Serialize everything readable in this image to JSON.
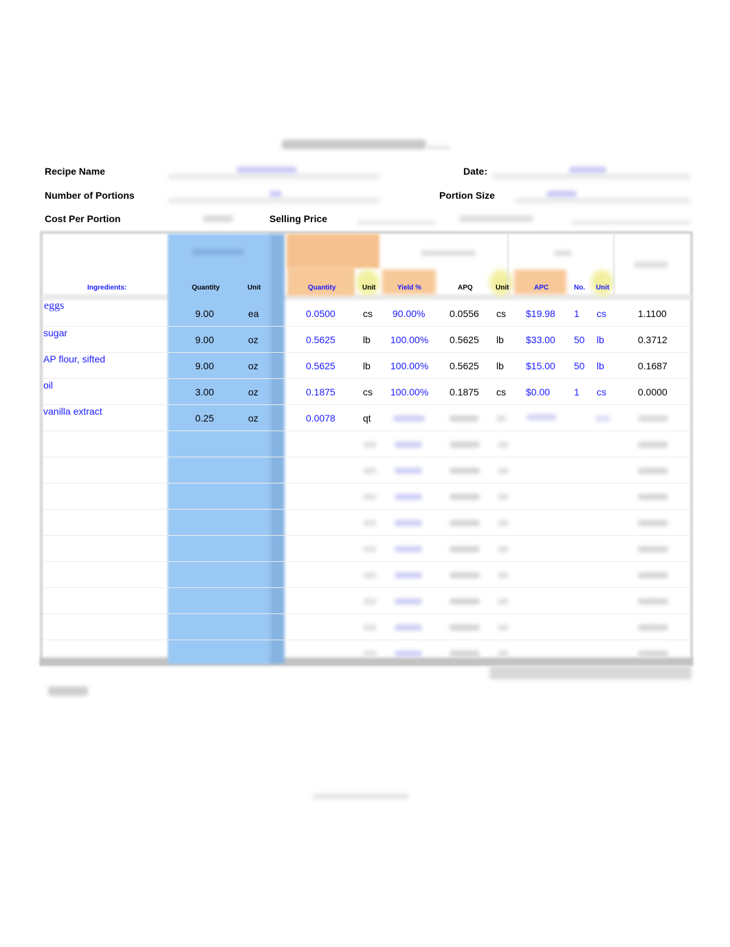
{
  "form": {
    "labels": {
      "recipe_name": "Recipe Name",
      "date": "Date:",
      "number_of_portions": "Number of Portions",
      "portion_size": "Portion Size",
      "cost_per_portion": "Cost Per Portion",
      "selling_price": "Selling Price"
    }
  },
  "table": {
    "headers": {
      "ingredients": "Ingredients:",
      "recipe_quantity": "Quantity",
      "recipe_unit": "Unit",
      "conv_quantity": "Quantity",
      "conv_unit": "Unit",
      "yield": "Yield %",
      "apq": "APQ",
      "apq_unit": "Unit",
      "apc": "APC",
      "no": "No.",
      "apc_unit": "Unit"
    },
    "rows": [
      {
        "ingredient": "eggs",
        "qty": "9.00",
        "unit": "ea",
        "conv_qty": "0.0500",
        "conv_unit": "cs",
        "yield": "90.00%",
        "apq": "0.0556",
        "apq_unit": "cs",
        "apc": "$19.98",
        "no": "1",
        "apc_unit": "cs",
        "cost": "1.1100"
      },
      {
        "ingredient": "sugar",
        "qty": "9.00",
        "unit": "oz",
        "conv_qty": "0.5625",
        "conv_unit": "lb",
        "yield": "100.00%",
        "apq": "0.5625",
        "apq_unit": "lb",
        "apc": "$33.00",
        "no": "50",
        "apc_unit": "lb",
        "cost": "0.3712"
      },
      {
        "ingredient": "AP flour, sifted",
        "qty": "9.00",
        "unit": "oz",
        "conv_qty": "0.5625",
        "conv_unit": "lb",
        "yield": "100.00%",
        "apq": "0.5625",
        "apq_unit": "lb",
        "apc": "$15.00",
        "no": "50",
        "apc_unit": "lb",
        "cost": "0.1687"
      },
      {
        "ingredient": "oil",
        "qty": "3.00",
        "unit": "oz",
        "conv_qty": "0.1875",
        "conv_unit": "cs",
        "yield": "100.00%",
        "apq": "0.1875",
        "apq_unit": "cs",
        "apc": "$0.00",
        "no": "1",
        "apc_unit": "cs",
        "cost": "0.0000"
      },
      {
        "ingredient": "vanilla extract",
        "qty": "0.25",
        "unit": "oz",
        "conv_qty": "0.0078",
        "conv_unit": "qt",
        "yield": "",
        "apq": "",
        "apq_unit": "",
        "apc": "",
        "no": "",
        "apc_unit": "",
        "cost": ""
      }
    ]
  },
  "colors": {
    "recipe_col_bg": "#9ac8f5",
    "conversion_header_bg": "#f7c492",
    "highlight_yellow": "#f2f29a",
    "input_text": "#1a1aff"
  }
}
